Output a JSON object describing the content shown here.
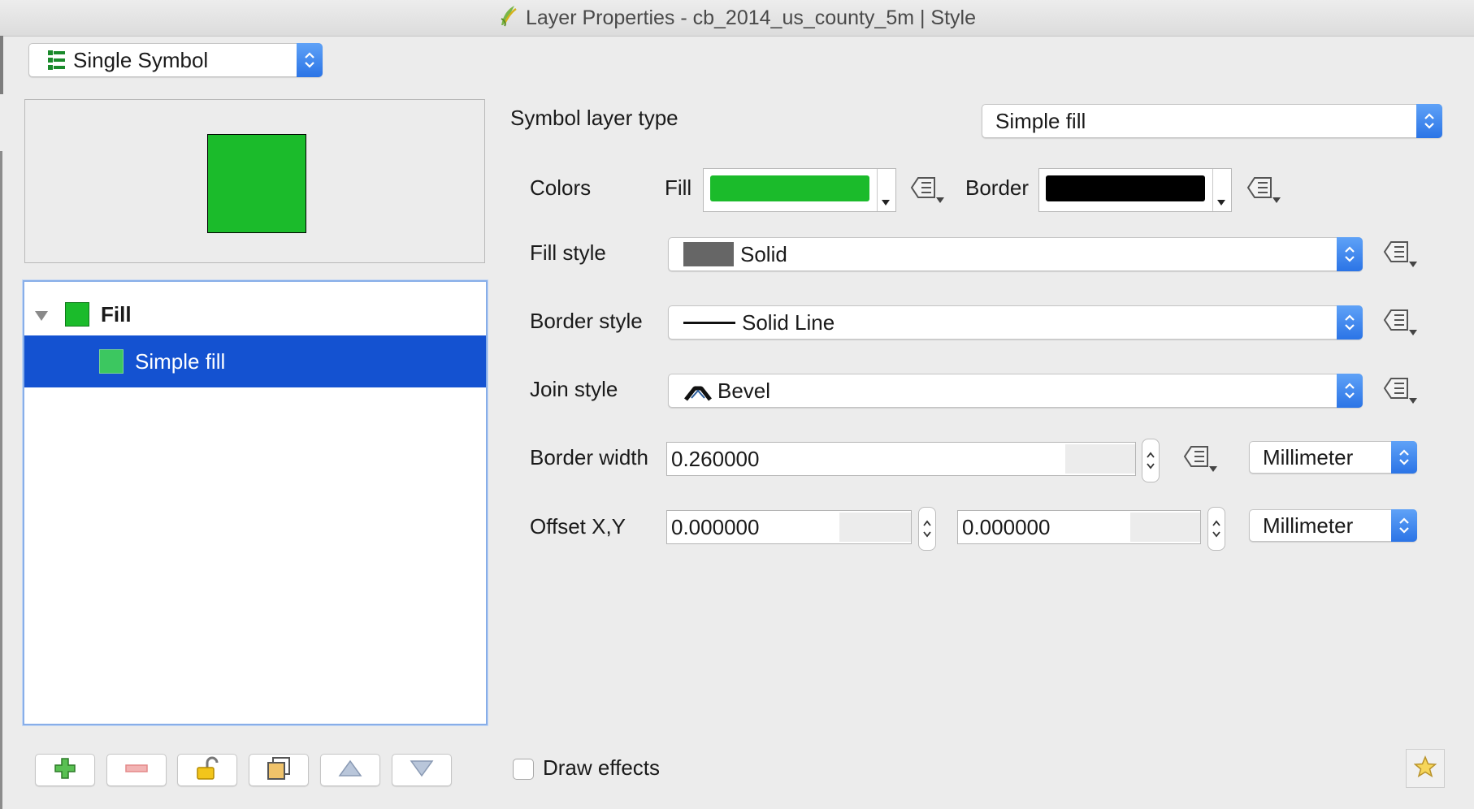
{
  "window": {
    "title": "Layer Properties - cb_2014_us_county_5m | Style",
    "icon": "qgis-icon"
  },
  "renderer": {
    "selected": "Single Symbol",
    "icon": "single-symbol-icon"
  },
  "symbol_tree": {
    "items": [
      {
        "label": "Fill",
        "icon": "fill-swatch",
        "color": "#1bbb2b",
        "expanded": true,
        "bold": true
      },
      {
        "label": "Simple fill",
        "icon": "simple-fill-swatch",
        "color": "#3cc760",
        "selected": true
      }
    ]
  },
  "preview": {
    "fill_color": "#1bbb2b",
    "border_color": "#000000"
  },
  "symbol_layer_type": {
    "label": "Symbol layer type",
    "value": "Simple fill"
  },
  "colors": {
    "label": "Colors",
    "fill_label": "Fill",
    "fill_color": "#1bbb2b",
    "border_label": "Border",
    "border_color": "#000000"
  },
  "fill_style": {
    "label": "Fill style",
    "value": "Solid",
    "swatch_color": "#666666"
  },
  "border_style": {
    "label": "Border style",
    "value": "Solid Line"
  },
  "join_style": {
    "label": "Join style",
    "value": "Bevel"
  },
  "border_width": {
    "label": "Border width",
    "value": "0.260000",
    "unit": "Millimeter"
  },
  "offset": {
    "label": "Offset X,Y",
    "x": "0.000000",
    "y": "0.000000",
    "unit": "Millimeter"
  },
  "bottom_toolbar": {
    "buttons": [
      "add-layer",
      "remove-layer",
      "lock-layer",
      "duplicate-layer",
      "move-up",
      "move-down"
    ]
  },
  "draw_effects": {
    "label": "Draw effects",
    "checked": false
  },
  "accent_color": "#2b74e6",
  "selection_color": "#1452d1"
}
